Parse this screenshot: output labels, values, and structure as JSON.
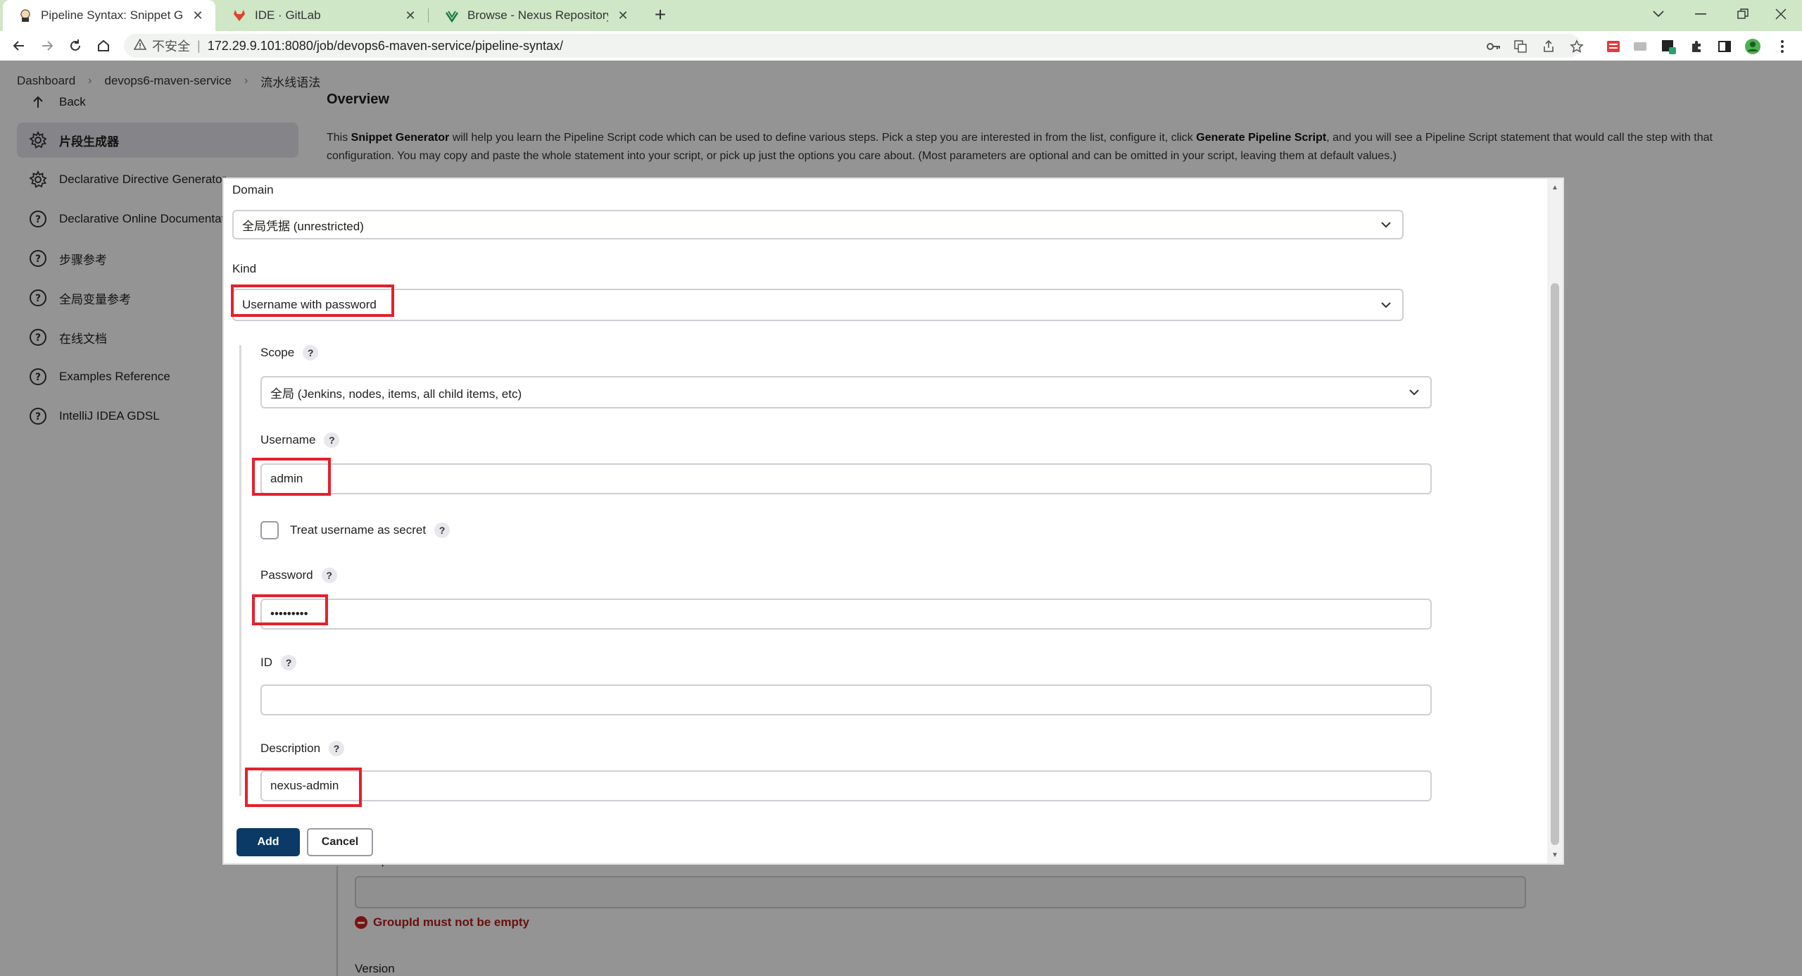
{
  "browser": {
    "tabs": [
      {
        "title": "Pipeline Syntax: Snippet Gener",
        "icon": "jenkins-butler-icon",
        "active": true
      },
      {
        "title": "IDE · GitLab",
        "icon": "gitlab-icon",
        "active": false
      },
      {
        "title": "Browse - Nexus Repository Ma",
        "icon": "nexus-icon",
        "active": false
      }
    ],
    "insecure_label": "不安全",
    "url": "172.29.9.101:8080/job/devops6-maven-service/pipeline-syntax/"
  },
  "breadcrumbs": [
    "Dashboard",
    "devops6-maven-service",
    "流水线语法"
  ],
  "sidebar": {
    "items": [
      {
        "label": "Back",
        "icon": "arrow-up-icon"
      },
      {
        "label": "片段生成器",
        "icon": "gear-icon",
        "active": true
      },
      {
        "label": "Declarative Directive Generator",
        "icon": "gear-icon"
      },
      {
        "label": "Declarative Online Documentation",
        "icon": "help-circle-icon"
      },
      {
        "label": "步骤参考",
        "icon": "help-circle-icon"
      },
      {
        "label": "全局变量参考",
        "icon": "help-circle-icon"
      },
      {
        "label": "在线文档",
        "icon": "help-circle-icon"
      },
      {
        "label": "Examples Reference",
        "icon": "help-circle-icon"
      },
      {
        "label": "IntelliJ IDEA GDSL",
        "icon": "help-circle-icon"
      }
    ]
  },
  "main": {
    "heading": "Overview",
    "intro_before": "This ",
    "intro_bold1": "Snippet Generator",
    "intro_mid": " will help you learn the Pipeline Script code which can be used to define various steps. Pick a step you are interested in from the list, configure it, click ",
    "intro_bold2": "Generate Pipeline Script",
    "intro_after": ", and you will see a Pipeline Script statement that would call the step with that configuration. You may copy and paste the whole statement into your script, or pick up just the options you care about. (Most parameters are optional and can be omitted in your script, leaving them at default values.)",
    "groupid_label": "GroupId",
    "groupid_error": "GroupId must not be empty",
    "version_label": "Version"
  },
  "dialog": {
    "domain_label": "Domain",
    "domain_value": "全局凭据 (unrestricted)",
    "kind_label": "Kind",
    "kind_value": "Username with password",
    "scope_label": "Scope",
    "scope_value": "全局 (Jenkins, nodes, items, all child items, etc)",
    "username_label": "Username",
    "username_value": "admin",
    "treat_secret_label": "Treat username as secret",
    "password_label": "Password",
    "password_value": "•••••••••",
    "id_label": "ID",
    "id_value": "",
    "description_label": "Description",
    "description_value": "nexus-admin",
    "help_glyph": "?",
    "add_label": "Add",
    "cancel_label": "Cancel"
  },
  "colors": {
    "tabstrip": "#cfe6c7",
    "primary_button": "#0c3a66",
    "highlight": "#e5202e",
    "error": "#b71c1c"
  }
}
